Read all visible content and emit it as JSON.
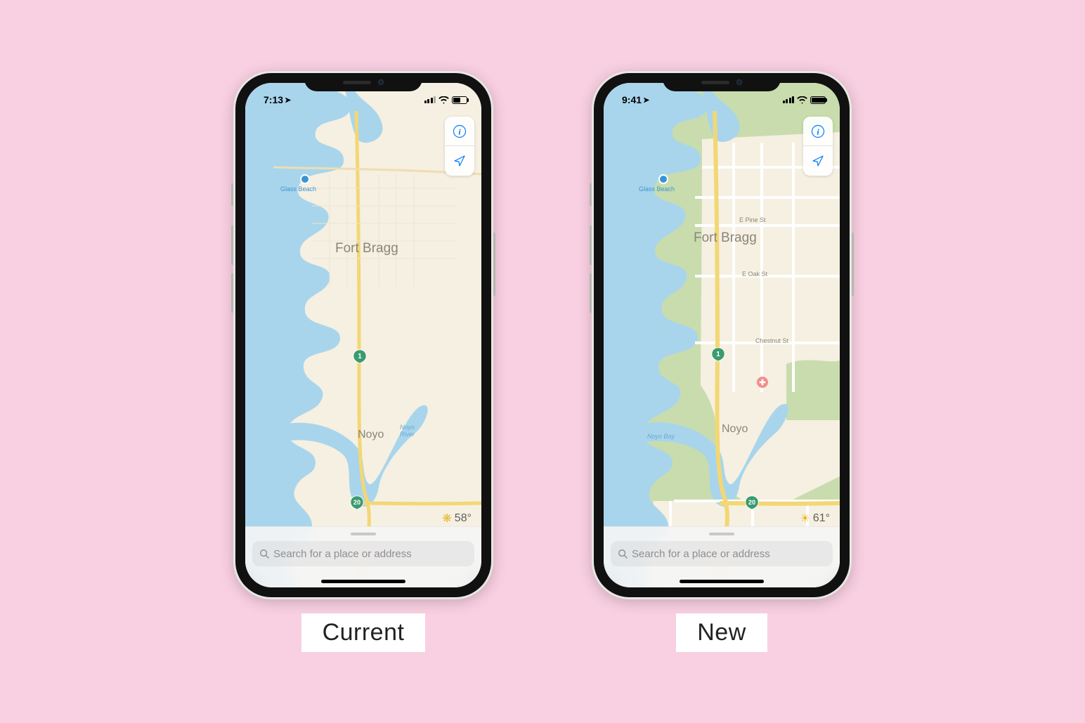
{
  "captions": {
    "left": "Current",
    "right": "New"
  },
  "left": {
    "time": "7:13",
    "battery_percent": 50,
    "weather_icon": "❋",
    "temperature": "58°",
    "search_placeholder": "Search for a place or address",
    "labels": {
      "city": "Fort Bragg",
      "glass_beach": "Glass Beach",
      "noyo": "Noyo",
      "noyo_river": "Noyo\nRiver",
      "route1": "1",
      "route20": "20"
    }
  },
  "right": {
    "time": "9:41",
    "battery_percent": 100,
    "weather_icon": "☀",
    "temperature": "61°",
    "search_placeholder": "Search for a place or address",
    "labels": {
      "city": "Fort Bragg",
      "glass_beach": "Glass Beach",
      "noyo": "Noyo",
      "noyo_bay": "Noyo Bay",
      "e_pine": "E Pine St",
      "e_oak": "E Oak St",
      "chestnut": "Chestnut St",
      "route1": "1",
      "route20": "20"
    }
  }
}
